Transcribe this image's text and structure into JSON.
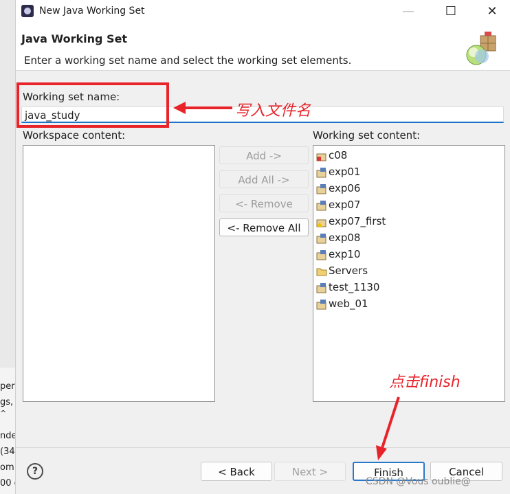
{
  "background": {
    "fragments": [
      "per",
      "gs,",
      "^",
      "nde",
      "(34",
      "om",
      "00 c"
    ]
  },
  "titlebar": {
    "title": "New Java Working Set",
    "minimize": "—",
    "maximize": "☐",
    "close": "✕"
  },
  "header": {
    "title": "Java Working Set",
    "description": "Enter a working set name and select the working set elements."
  },
  "form": {
    "name_label": "Working set name:",
    "name_value": "java_study",
    "workspace_label": "Workspace content:",
    "working_set_label": "Working set content:"
  },
  "middle_buttons": {
    "add": "Add ->",
    "add_all": "Add All ->",
    "remove": "<- Remove",
    "remove_all": "<- Remove All"
  },
  "working_set_items": [
    "c08",
    "exp01",
    "exp06",
    "exp07",
    "exp07_first",
    "exp08",
    "exp10",
    "Servers",
    "test_1130",
    "web_01"
  ],
  "footer": {
    "help": "?",
    "back": "< Back",
    "next": "Next >",
    "finish": "Finish",
    "cancel": "Cancel"
  },
  "annotations": {
    "name_note": "写入文件名",
    "finish_note": "点击finish",
    "color": "#e8232a"
  },
  "watermark": "CSDN @Vous oublie@"
}
